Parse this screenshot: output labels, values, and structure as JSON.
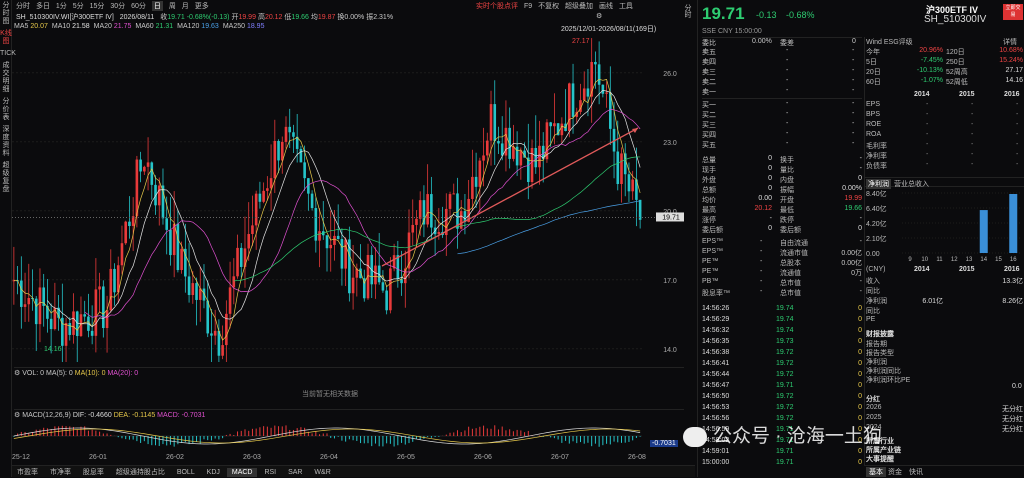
{
  "header": {
    "symbol": "SH_510300IV.WI[沪300ETF IV]",
    "date": "2026/08/11",
    "close_lbl": "收",
    "close": "19.71",
    "chg": "-0.68%(-0.13)",
    "open_lbl": "开",
    "open": "19.99",
    "high_lbl": "高",
    "high": "20.12",
    "low_lbl": "低",
    "low": "19.66",
    "avg_lbl": "均",
    "avg": "19.87",
    "turn_lbl": "换",
    "turn": "0.00%",
    "amp_lbl": "振",
    "amp": "2.31%",
    "top_links": [
      "实时个股点评",
      "F9",
      "不复权",
      "超级叠加",
      "画线",
      "工具"
    ],
    "range": "2025/12/01-2026/08/11(169日)"
  },
  "toolbar": [
    "分时",
    "多日",
    "1分",
    "5分",
    "15分",
    "30分",
    "60分",
    "日",
    "周",
    "月",
    "更多"
  ],
  "ma_line": [
    {
      "label": "MA5",
      "value": "20.07",
      "color": "#e6c84a"
    },
    {
      "label": "MA10",
      "value": "21.58",
      "color": "#e4e4e4"
    },
    {
      "label": "MA20",
      "value": "21.75",
      "color": "#e050d0"
    },
    {
      "label": "MA60",
      "value": "21.31",
      "color": "#2ecc71"
    },
    {
      "label": "MA120",
      "value": "19.63",
      "color": "#4aa0e6"
    },
    {
      "label": "MA250",
      "value": "18.95",
      "color": "#8080ff"
    }
  ],
  "sidebar": [
    "分时图",
    "K线图",
    "TICK",
    "成交明细",
    "分价表",
    "深度资料",
    "超级复盘"
  ],
  "price_axis": [
    "26.0",
    "23.0",
    "20.0",
    "17.0",
    "14.0"
  ],
  "price_marks": {
    "max": "27.17",
    "min": "14.16",
    "last": "19.71"
  },
  "vol": {
    "label": "VOL: 0",
    "ma5": "MA(5): 0",
    "ma10": "MA(10): 0",
    "ma20": "MA(20): 0",
    "empty": "当前暂无相关数据"
  },
  "macd": {
    "label": "MACD(12,26,9)",
    "dif": "DIF: -0.4660",
    "dea": "DEA: -0.1145",
    "macd": "MACD: -0.7031",
    "axis_val": "-0.7031"
  },
  "date_axis": [
    "25-12",
    "26-01",
    "26-02",
    "26-03",
    "26-04",
    "26-05",
    "26-06",
    "26-07",
    "26-08"
  ],
  "bottom_tabs": [
    "市盈率",
    "市净率",
    "股息率",
    "超级通持股占比",
    "BOLL",
    "KDJ",
    "MACD",
    "RSI",
    "SAR",
    "W&R"
  ],
  "quote": {
    "title": "沪300ETF IV",
    "code": "SH_510300IV",
    "badge": "立即交易",
    "price": "19.71",
    "chg": "-0.13",
    "pct": "-0.68%",
    "sse": "SSE",
    "cny": "CNY",
    "time": "15:00:00",
    "ratio_lbl": "委比",
    "ratio": "0.00%",
    "diff_lbl": "委差",
    "diff": "0",
    "sell": [
      [
        "卖五",
        "-",
        "-"
      ],
      [
        "卖四",
        "-",
        "-"
      ],
      [
        "卖三",
        "-",
        "-"
      ],
      [
        "卖二",
        "-",
        "-"
      ],
      [
        "卖一",
        "-",
        "-"
      ]
    ],
    "buy": [
      [
        "买一",
        "-",
        "-"
      ],
      [
        "买二",
        "-",
        "-"
      ],
      [
        "买三",
        "-",
        "-"
      ],
      [
        "买四",
        "-",
        "-"
      ],
      [
        "买五",
        "-",
        "-"
      ]
    ],
    "stats": [
      [
        "总量",
        "0",
        "换手",
        "-"
      ],
      [
        "现手",
        "0",
        "量比",
        "-"
      ],
      [
        "外盘",
        "0",
        "内盘",
        "0"
      ],
      [
        "总额",
        "0",
        "振幅",
        "0.00%"
      ],
      [
        "均价",
        "0.00",
        "开盘",
        "19.99"
      ],
      [
        "最高",
        "20.12",
        "最低",
        "19.66"
      ],
      [
        "涨停",
        "-",
        "跌停",
        "-"
      ],
      [
        "委后额",
        "0",
        "委后额",
        "0"
      ]
    ],
    "fin": [
      [
        "EPS™",
        "-",
        "自由流通",
        "-"
      ],
      [
        "EPS™",
        "-",
        "流通市值",
        "0.00亿"
      ],
      [
        "PE™",
        "-",
        "总股本",
        "0.00亿"
      ],
      [
        "PE™",
        "-",
        "流通值",
        "0万"
      ],
      [
        "PB™",
        "-",
        "总市值",
        "-"
      ],
      [
        "股息率™",
        "-",
        "总市值",
        "-"
      ]
    ],
    "ticks": [
      [
        "14:56:26",
        "19.74",
        "0"
      ],
      [
        "14:56:29",
        "19.74",
        "0"
      ],
      [
        "14:56:32",
        "19.74",
        "0"
      ],
      [
        "14:56:35",
        "19.73",
        "0"
      ],
      [
        "14:56:38",
        "19.72",
        "0"
      ],
      [
        "14:56:41",
        "19.72",
        "0"
      ],
      [
        "14:56:44",
        "19.72",
        "0"
      ],
      [
        "14:56:47",
        "19.71",
        "0"
      ],
      [
        "14:56:50",
        "19.72",
        "0"
      ],
      [
        "14:56:53",
        "19.72",
        "0"
      ],
      [
        "14:56:56",
        "19.72",
        "0"
      ],
      [
        "14:56:59",
        "19.71",
        "0"
      ],
      [
        "14:58:02",
        "19.71",
        "0"
      ],
      [
        "14:59:01",
        "19.71",
        "0"
      ],
      [
        "15:00:00",
        "19.71",
        "0"
      ]
    ]
  },
  "esg": {
    "title": "Wind ESG评级",
    "link": "详情",
    "rows": [
      [
        "今年",
        "20.96%",
        "120日",
        "10.68%"
      ],
      [
        "5日",
        "-7.45%",
        "250日",
        "15.24%"
      ],
      [
        "20日",
        "-10.13%",
        "52周高",
        "27.17"
      ],
      [
        "60日",
        "-1.07%",
        "52周低",
        "14.16"
      ]
    ],
    "years": [
      "2014",
      "2015",
      "2016"
    ],
    "metrics": [
      "EPS",
      "BPS",
      "ROE",
      "ROA",
      "毛利率",
      "净利率",
      "负债率"
    ]
  },
  "profit": {
    "tab1": "净利润",
    "tab2": "营业总收入",
    "y_axis": [
      "8.40亿",
      "6.40亿",
      "4.20亿",
      "2.10亿",
      "0.00"
    ],
    "x_axis": [
      "9",
      "10",
      "11",
      "12",
      "13",
      "14",
      "15",
      "16"
    ],
    "years": [
      "2014",
      "2015",
      "2016"
    ],
    "unit": "(CNY)",
    "rows": [
      [
        "收入",
        "",
        "13.3亿"
      ],
      [
        "同比",
        "",
        ""
      ],
      [
        "净利润",
        "6.01亿",
        "8.26亿"
      ],
      [
        "同比",
        "",
        ""
      ],
      [
        "PE",
        "",
        ""
      ]
    ]
  },
  "chart_data": {
    "type": "bar",
    "title": "净利润",
    "categories": [
      "9",
      "10",
      "11",
      "12",
      "13",
      "14",
      "15",
      "16"
    ],
    "values": [
      0,
      0,
      0,
      0,
      0,
      6.01,
      0,
      8.26
    ],
    "ylim": [
      0,
      8.4
    ]
  },
  "events": {
    "title": "财报披露",
    "rows": [
      "报告期",
      "报告类型",
      "净利润",
      "净利润同比",
      "净利润环比PE"
    ],
    "val": "0.0"
  },
  "dividend": {
    "title": "分红",
    "rows": [
      [
        "2026",
        "无分红"
      ],
      [
        "2025",
        "无分红"
      ],
      [
        "2024",
        "无分红"
      ]
    ]
  },
  "extra": [
    "所属行业",
    "所属产业链",
    "大事提醒"
  ],
  "right_tabs": [
    "基本",
    "资金",
    "快讯"
  ],
  "watermark": "公众号 · 沧海一土狗"
}
